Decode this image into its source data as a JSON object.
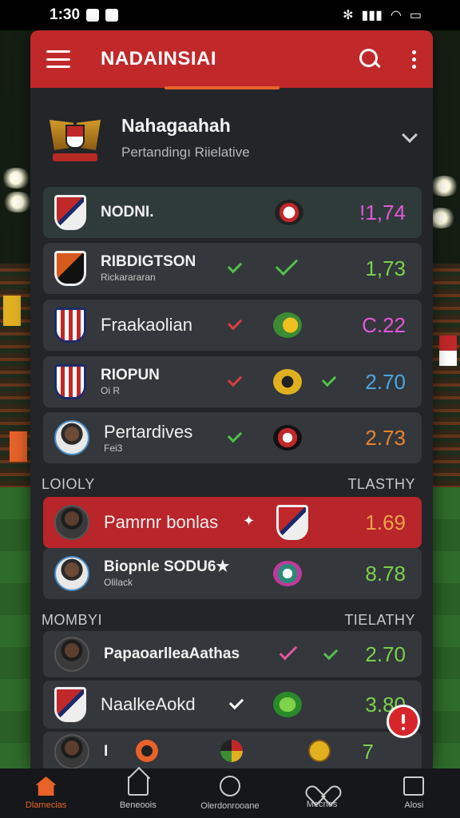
{
  "status_bar": {
    "time": "1:30"
  },
  "app_bar": {
    "title": "NADAINSIAI"
  },
  "league": {
    "name": "Nahagaahah",
    "subtitle": "Pertandingı Riielative"
  },
  "rows": [
    {
      "name": "NODNI.",
      "odds": "ǃ1,74",
      "odds_color": "#e257d8"
    },
    {
      "name": "RIBDIGTSON",
      "sub": "Rickarararan",
      "odds": "1,73",
      "odds_color": "#7ad24a"
    },
    {
      "name": "Fraakaolian",
      "odds": "C.22",
      "odds_color": "#e257d8"
    },
    {
      "name": "RIOPUN",
      "sub": "Oi R",
      "odds": "2.70",
      "odds_color": "#4aa6e0"
    },
    {
      "name": "Pertardives",
      "sub": "Fei3",
      "odds": "2.73",
      "odds_color": "#e8842a"
    }
  ],
  "section1": {
    "left": "LOIOLY",
    "right": "TLASTHY"
  },
  "featured": [
    {
      "name": "Pamrnr bonlas",
      "odds": "1.69",
      "odds_color": "#f0a24a"
    },
    {
      "name": "Biopnle SODU6★",
      "sub": "Olilack",
      "odds": "8.78",
      "odds_color": "#7ad24a"
    }
  ],
  "section2": {
    "left": "MOMBYI",
    "right": "TIELATHY"
  },
  "more_rows": [
    {
      "name": "PapaoarlleаAathas",
      "odds": "2.70",
      "odds_color": "#7ad24a"
    },
    {
      "name": "NaalkeAokd",
      "odds": "3.80",
      "odds_color": "#7ad24a"
    },
    {
      "name": "I",
      "odds": "7",
      "odds_color": "#7ad24a"
    }
  ],
  "bottom_nav": [
    {
      "label": "Dlamecias"
    },
    {
      "label": "Beneoois"
    },
    {
      "label": "Olerdonrooane"
    },
    {
      "label": "Mecnos"
    },
    {
      "label": "Alosi"
    }
  ]
}
